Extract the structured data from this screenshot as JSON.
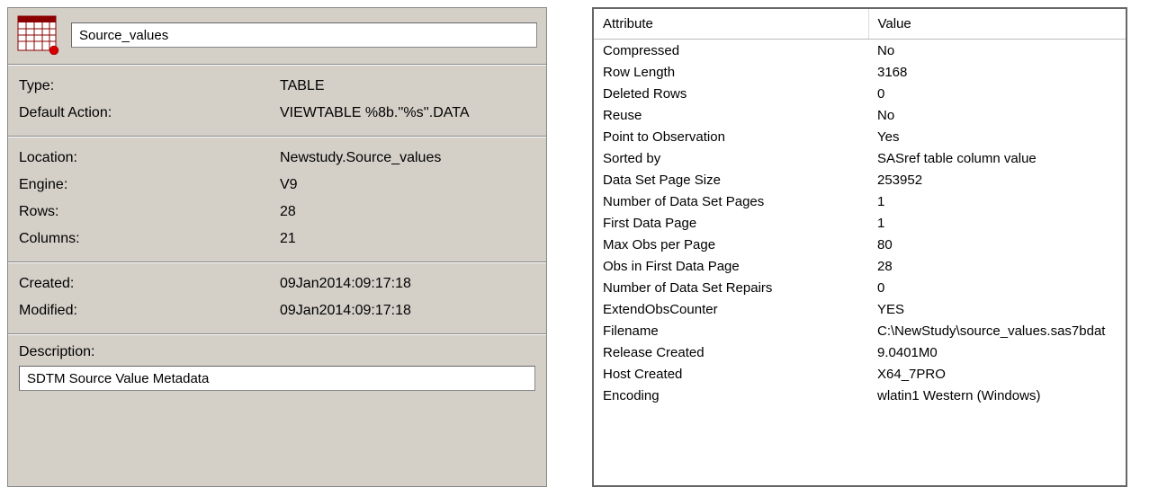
{
  "left": {
    "name_value": "Source_values",
    "props1": [
      {
        "label": "Type:",
        "value": "TABLE"
      },
      {
        "label": "Default Action:",
        "value": "VIEWTABLE %8b.''%s''.DATA"
      }
    ],
    "props2": [
      {
        "label": "Location:",
        "value": "Newstudy.Source_values"
      },
      {
        "label": "Engine:",
        "value": "V9"
      },
      {
        "label": "Rows:",
        "value": "28"
      },
      {
        "label": "Columns:",
        "value": "21"
      }
    ],
    "props3": [
      {
        "label": "Created:",
        "value": "09Jan2014:09:17:18"
      },
      {
        "label": "Modified:",
        "value": "09Jan2014:09:17:18"
      }
    ],
    "desc_label": "Description:",
    "desc_value": "SDTM Source Value Metadata"
  },
  "right": {
    "header_attr": "Attribute",
    "header_val": "Value",
    "rows": [
      {
        "attr": "Compressed",
        "val": "No"
      },
      {
        "attr": "Row Length",
        "val": "3168"
      },
      {
        "attr": "Deleted Rows",
        "val": "0"
      },
      {
        "attr": "Reuse",
        "val": "No"
      },
      {
        "attr": "Point to Observation",
        "val": "Yes"
      },
      {
        "attr": "Sorted by",
        "val": "SASref table column value"
      },
      {
        "attr": "Data Set Page Size",
        "val": "253952"
      },
      {
        "attr": "Number of Data Set Pages",
        "val": "1"
      },
      {
        "attr": "First Data Page",
        "val": "1"
      },
      {
        "attr": "Max Obs per Page",
        "val": "80"
      },
      {
        "attr": "Obs in First Data Page",
        "val": "28"
      },
      {
        "attr": "Number of Data Set Repairs",
        "val": "0"
      },
      {
        "attr": "ExtendObsCounter",
        "val": "YES"
      },
      {
        "attr": "Filename",
        "val": "C:\\NewStudy\\source_values.sas7bdat"
      },
      {
        "attr": "Release Created",
        "val": "9.0401M0"
      },
      {
        "attr": "Host Created",
        "val": "X64_7PRO"
      },
      {
        "attr": "Encoding",
        "val": "wlatin1  Western (Windows)"
      }
    ]
  }
}
